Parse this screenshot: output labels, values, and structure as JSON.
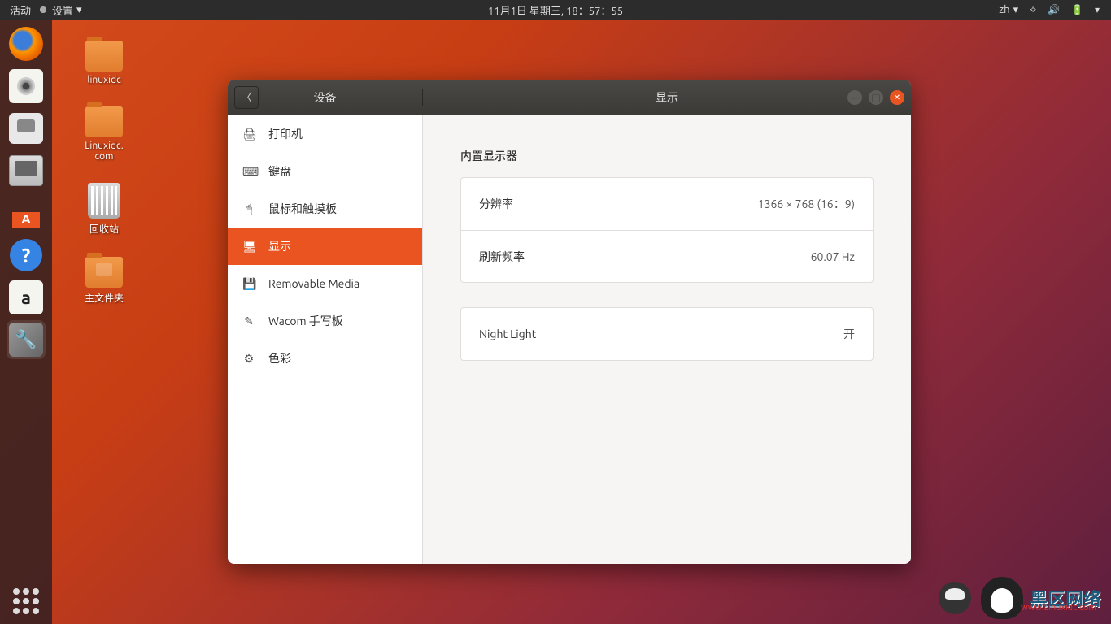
{
  "top_panel": {
    "activities": "活动",
    "app_menu": "设置",
    "datetime": "11月1日 星期三, 18：57：55",
    "input_method": "zh"
  },
  "desktop": {
    "icons": [
      {
        "label": "linuxidc"
      },
      {
        "label": "Linuxidc.\ncom"
      },
      {
        "label": "回收站"
      },
      {
        "label": "主文件夹"
      }
    ]
  },
  "window": {
    "back_section": "设备",
    "title": "显示",
    "sidebar": [
      {
        "icon": "🖨",
        "label": "打印机"
      },
      {
        "icon": "⌨",
        "label": "键盘"
      },
      {
        "icon": "🖱",
        "label": "鼠标和触摸板"
      },
      {
        "icon": "🖥",
        "label": "显示",
        "selected": true
      },
      {
        "icon": "💾",
        "label": "Removable Media"
      },
      {
        "icon": "✎",
        "label": "Wacom 手写板"
      },
      {
        "icon": "⚙",
        "label": "色彩"
      }
    ],
    "content": {
      "section_title": "内置显示器",
      "rows": [
        {
          "label": "分辨率",
          "value": "1366 × 768 (16：9)"
        },
        {
          "label": "刷新频率",
          "value": "60.07 Hz"
        }
      ],
      "night_light": {
        "label": "Night Light",
        "value": "开"
      }
    }
  },
  "watermark": {
    "text": "黑区网络",
    "sub": "www.Linuxidc.com"
  }
}
